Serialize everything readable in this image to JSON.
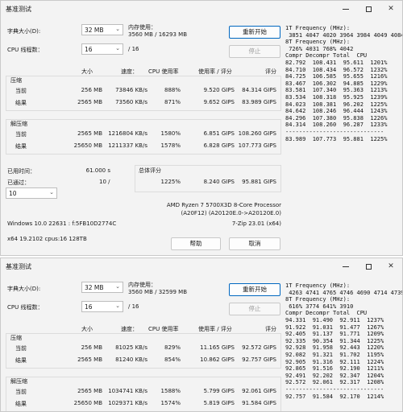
{
  "w1": {
    "title": "基准测试",
    "dict_label": "字典大小(D):",
    "dict_value": "32 MB",
    "mem_label": "内存使用：",
    "mem_value": "3560 MB / 16293 MB",
    "restart": "重新开始",
    "threads_label": "CPU 线程数：",
    "threads_value": "16",
    "threads_total": "/ 16",
    "stop": "停止",
    "headers": {
      "size": "大小",
      "speed": "速度：",
      "cpu": "CPU 使用率",
      "cpu_rating": "使用率 / 评分",
      "rating": "评分"
    },
    "compress_title": "压缩",
    "decompress_title": "解压缩",
    "rows": [
      {
        "label": "当前",
        "size": "256 MB",
        "speed": "73846 KB/s",
        "cpu": "888%",
        "rr": "9.520 GIPS",
        "rating": "84.314 GIPS"
      },
      {
        "label": "结果",
        "size": "2565 MB",
        "speed": "73560 KB/s",
        "cpu": "871%",
        "rr": "9.652 GIPS",
        "rating": "83.989 GIPS"
      },
      {
        "label": "当前",
        "size": "2565 MB",
        "speed": "1216804 KB/s",
        "cpu": "1580%",
        "rr": "6.851 GIPS",
        "rating": "108.260 GIPS"
      },
      {
        "label": "结果",
        "size": "25650 MB",
        "speed": "1211337 KB/s",
        "cpu": "1578%",
        "rr": "6.828 GIPS",
        "rating": "107.773 GIPS"
      }
    ],
    "elapsed_label": "已用时间：",
    "elapsed_value": "61.000 s",
    "passes_label": "已通过：",
    "passes_value": "10 /",
    "passes_select": "10",
    "total_label": "总体评分",
    "total_cpu": "1225%",
    "total_rr": "8.240 GIPS",
    "total_rating": "95.881 GIPS",
    "cpu_name": "AMD Ryzen 7 5700X3D 8-Core Processor",
    "cpu_id": "(A20F12) (A20120E.0->A20120E.0)",
    "os": "Windows 10.0 22631 : f:5FB10D2774C",
    "zip_ver": "7-Zip 23.01 (x64)",
    "cpu_info": "x64 19.2102 cpus:16 128TB",
    "help": "帮助",
    "cancel": "取消",
    "side": [
      "1T Frequency (MHz):",
      " 3851 4047 4020 3964 3984 4049 4084",
      "8T Frequency (MHz):",
      " 726% 4031 768% 4042",
      "Compr Decompr Total  CPU",
      "82.792  108.431  95.611  1201%",
      "84.710  108.434  96.572  1232%",
      "84.725  106.585  95.655  1216%",
      "83.467  106.302  94.885  1229%",
      "83.581  107.340  95.363  1213%",
      "83.534  108.318  95.925  1239%",
      "84.023  108.381  96.202  1225%",
      "84.642  108.246  96.444  1243%",
      "84.296  107.380  95.838  1226%",
      "84.314  108.260  96.287  1233%",
      "-----------------------------",
      "83.989  107.773  95.881  1225%"
    ]
  },
  "w2": {
    "title": "基准测试",
    "dict_label": "字典大小(D):",
    "dict_value": "32 MB",
    "mem_label": "内存使用：",
    "mem_value": "3560 MB / 32599 MB",
    "restart": "重新开始",
    "threads_label": "CPU 线程数：",
    "threads_value": "16",
    "threads_total": "/ 16",
    "stop": "停止",
    "headers": {
      "size": "大小",
      "speed": "速度：",
      "cpu": "CPU 使用率",
      "cpu_rating": "使用率 / 评分",
      "rating": "评分"
    },
    "compress_title": "压缩",
    "decompress_title": "解压缩",
    "rows": [
      {
        "label": "当前",
        "size": "256 MB",
        "speed": "81025 KB/s",
        "cpu": "829%",
        "rr": "11.165 GIPS",
        "rating": "92.572 GIPS"
      },
      {
        "label": "结果",
        "size": "2565 MB",
        "speed": "81240 KB/s",
        "cpu": "854%",
        "rr": "10.862 GIPS",
        "rating": "92.757 GIPS"
      },
      {
        "label": "当前",
        "size": "2565 MB",
        "speed": "1034741 KB/s",
        "cpu": "1588%",
        "rr": "5.799 GIPS",
        "rating": "92.061 GIPS"
      },
      {
        "label": "结果",
        "size": "25650 MB",
        "speed": "1029371 KB/s",
        "cpu": "1574%",
        "rr": "5.819 GIPS",
        "rating": "91.584 GIPS"
      }
    ],
    "side": [
      "1T Frequency (MHz):",
      " 4263 4741 4765 4746 4690 4714 4739",
      "8T Frequency (MHz):",
      " 616% 3774 641% 3910",
      "Compr Decompr Total  CPU",
      "94.331  91.490  92.911  1237%",
      "91.922  91.031  91.477  1267%",
      "92.405  91.137  91.771  1209%",
      "92.335  90.354  91.344  1225%",
      "92.928  91.958  92.443  1220%",
      "92.082  91.321  91.702  1195%",
      "92.905  91.316  92.111  1224%",
      "92.865  91.516  92.190  1211%",
      "92.491  92.202  92.347  1204%",
      "92.572  92.061  92.317  1208%",
      "-----------------------------",
      "92.757  91.584  92.170  1214%"
    ]
  }
}
